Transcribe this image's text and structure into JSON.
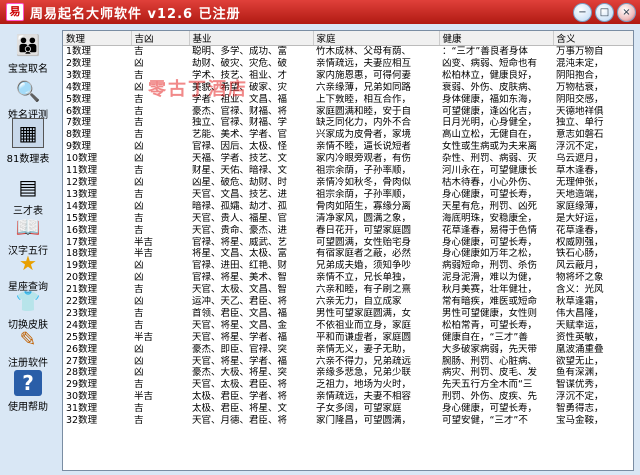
{
  "window": {
    "title": "周易起名大师软件  v12.6   已注册",
    "buttons": [
      "−",
      "□",
      "×"
    ]
  },
  "watermark": "零古丁酒店",
  "sidebar": {
    "items": [
      {
        "label": "宝宝取名",
        "icon": "family-icon",
        "glyph": "👪"
      },
      {
        "label": "姓名评测",
        "icon": "magnifier-icon",
        "glyph": "🔍"
      },
      {
        "label": "81数理表",
        "icon": "table-icon",
        "glyph": "▦"
      },
      {
        "label": "三才表",
        "icon": "document-icon",
        "glyph": "▤"
      },
      {
        "label": "汉字五行",
        "icon": "book-icon",
        "glyph": "📖"
      },
      {
        "label": "星座查询",
        "icon": "star-icon",
        "glyph": "★"
      },
      {
        "label": "切换皮肤",
        "icon": "shirt-icon",
        "glyph": "👕"
      },
      {
        "label": "注册软件",
        "icon": "pencil-icon",
        "glyph": "✎"
      },
      {
        "label": "使用帮助",
        "icon": "help-icon",
        "glyph": "?"
      }
    ]
  },
  "table": {
    "headers": [
      "数理",
      "吉凶",
      "基业",
      "家庭",
      "健康",
      "含义"
    ],
    "rows": [
      [
        "1数理",
        "吉",
        "聪明、多学、成功、富",
        "竹木成林、父母有荫、",
        "：“三才”善良者身体",
        "万事万物自"
      ],
      [
        "2数理",
        "凶",
        "劫财、破灾、灾危、破",
        "亲情疏远，夫妻应相互",
        "凶变、病弱、短命也有",
        "混沌未定，"
      ],
      [
        "3数理",
        "吉",
        "学术、技艺、祖业、才",
        "家内施恩惠，可得何妻",
        "松柏林立，健康良好，",
        "阴阳抱合，"
      ],
      [
        "4数理",
        "凶",
        "美貌、希望、破家、灾",
        "六亲缘薄，兄弟如同路",
        "衰弱、外伤、皮肤病、",
        "万物枯衰，"
      ],
      [
        "5数理",
        "吉",
        "学者、祖业、文昌、福",
        "上下敦睦，相互合作，",
        "身体健康，福如东海，",
        "阴阳交感，"
      ],
      [
        "6数理",
        "吉",
        "豪杰、官禄、财福、将",
        "家庭圆满和睦，安于自",
        "可望健康，逢凶化吉，",
        "天德地祥俱"
      ],
      [
        "7数理",
        "吉",
        "独立、官禄、财福、学",
        "缺乏同化力，内外不合",
        "日月光明，心身健全，",
        "独立、单行"
      ],
      [
        "8数理",
        "吉",
        "艺能、美术、学者、官",
        "兴家成为皮骨者，家境",
        "高山立松，无健自在，",
        "意志如磐石"
      ],
      [
        "9数理",
        "凶",
        "官禄、因后、太极、怪",
        "亲情不睦，逼长说短者",
        "女性或生病或为夫来离",
        "浮沉不定，"
      ],
      [
        "10数理",
        "凶",
        "天福、学者、技艺、文",
        "家内冷眼旁观者，有伤",
        "杂性、刑罚、病弱、灭",
        "乌云遮月，"
      ],
      [
        "11数理",
        "吉",
        "财星、天佑、暗禄、文",
        "祖宗余荫，子孙率顺，",
        "河川永在，可望健康长",
        "草木逢春，"
      ],
      [
        "12数理",
        "凶",
        "凶星、破危、劫财、时",
        "亲情冷如秋冬，骨肉似",
        "枯木待春，小心外伤、",
        "无理伸张，"
      ],
      [
        "13数理",
        "吉",
        "天官、文昌、技艺、进",
        "祖宗余荫，子孙率顺，",
        "身心健康，可望长寿，",
        "天地造端，"
      ],
      [
        "14数理",
        "凶",
        "暗禄、孤孀、劫才、孤",
        "骨肉如陌生，寡缘分离",
        "天星有危，刑罚、凶死",
        "家庭缘薄，"
      ],
      [
        "15数理",
        "吉",
        "天官、贵人、福星、官",
        "清净家风，圆满之象，",
        "海底明珠，安稳康全，",
        "是大好运，"
      ],
      [
        "16数理",
        "吉",
        "天官、贵命、豪杰、进",
        "春日花开，可望家庭圆",
        "花草逢春，易得于色情",
        "花草逢春，"
      ],
      [
        "17数理",
        "半吉",
        "官禄、将星、威武、艺",
        "可望圆满，女性贻宅身",
        "身心健康，可望长寿，",
        "权威刚强，"
      ],
      [
        "18数理",
        "半吉",
        "将星、文昌、太极、富",
        "有宿家庭者之蔽，必然",
        "身心健康如万年之松，",
        "铁石心肠，"
      ],
      [
        "19数理",
        "凶",
        "官禄、进田、红艳、财",
        "兄弟成夫婚，须知争吵",
        "病弱短命，刑罚、杀伤",
        "风云蔽月，"
      ],
      [
        "20数理",
        "凶",
        "官禄、将星、美术、智",
        "亲情不立，兄长单独，",
        "泥身泥滑，难以为健，",
        "物将坏之象"
      ],
      [
        "21数理",
        "吉",
        "天官、太极、文昌、智",
        "六亲和睦，有子刷之熹",
        "秋月美赛，壮年健壮，",
        "含义：光风"
      ],
      [
        "22数理",
        "凶",
        "运冲、天乙、君臣、将",
        "六亲无力，自立成家",
        "常有暗疾，难医或短命",
        "秋草逢霜，"
      ],
      [
        "23数理",
        "吉",
        "首领、君臣、文昌、福",
        "男性可望家庭圆满，女",
        "男性可望健康，女性则",
        "伟大昌隆，"
      ],
      [
        "24数理",
        "吉",
        "天官、将星、文昌、金",
        "不依祖业而立身，家庭",
        "松柏常青，可望长寿，",
        "天赋幸运，"
      ],
      [
        "25数理",
        "半吉",
        "天官、将星、学者、福",
        "平和而谦虚者，家庭圆",
        "健康自在，“三才”善",
        "资性英敏，"
      ],
      [
        "26数理",
        "凶",
        "豪杰、即臣、官禄、突",
        "亲情无义，妻子无助，",
        "大多破家病弱，先天带",
        "凰波涌重叠"
      ],
      [
        "27数理",
        "凶",
        "天官、将星、学者、福",
        "六亲不得力，兄弟疏远",
        "腕肠、刑罚、心脏病、",
        "欲望无止，"
      ],
      [
        "28数理",
        "凶",
        "豪杰、大极、将星、突",
        "亲缘多悲急，兄弟少联",
        "病灾、刑罚、皮毛、发",
        "鱼有深渊，"
      ],
      [
        "29数理",
        "吉",
        "天官、太极、君臣、将",
        "乏祖力，地场为火时，",
        "先天五行方全木而“三",
        "智谋优秀，"
      ],
      [
        "30数理",
        "半吉",
        "太极、君臣、学者、将",
        "亲情疏远，夫妻不相容",
        "刑罚、外伤、皮疾、先",
        "浮沉不定，"
      ],
      [
        "31数理",
        "吉",
        "太极、君臣、将星、文",
        "子女多阔，可望家庭",
        "身心健康，可望长寿，",
        "智勇得志，"
      ],
      [
        "32数理",
        "吉",
        "天官、月德、君臣、将",
        "家门隆昌，可望圆满，",
        "可望安健，“三才”不",
        "宝马金鞍，"
      ]
    ]
  }
}
